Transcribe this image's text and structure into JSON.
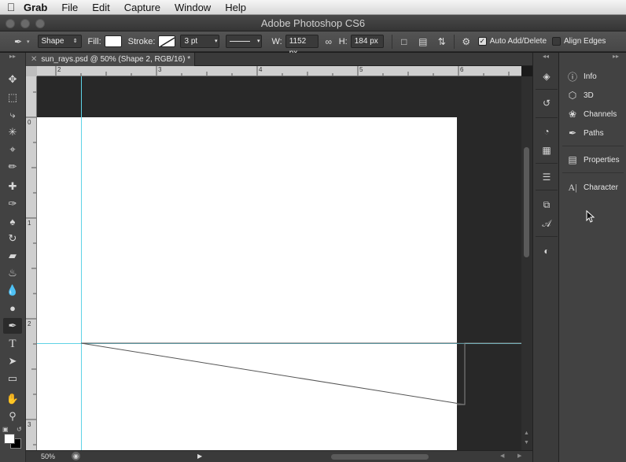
{
  "menubar": {
    "app_name": "Grab",
    "items": [
      "File",
      "Edit",
      "Capture",
      "Window",
      "Help"
    ]
  },
  "window": {
    "title": "Adobe Photoshop CS6"
  },
  "options": {
    "tool_mode": "Shape",
    "fill_label": "Fill:",
    "stroke_label": "Stroke:",
    "stroke_width": "3 pt",
    "w_label": "W:",
    "w_value": "1152 px",
    "h_label": "H:",
    "h_value": "184 px",
    "auto_add_delete": "Auto Add/Delete",
    "auto_add_delete_checked": true,
    "align_edges": "Align Edges",
    "align_edges_checked": false
  },
  "document": {
    "tab_title": "sun_rays.psd @ 50% (Shape 2, RGB/16) *",
    "zoom": "50%",
    "hruler_labels": [
      "2",
      "3",
      "4",
      "5",
      "6"
    ],
    "vruler_labels": [
      "0",
      "1",
      "2",
      "3"
    ]
  },
  "panels": [
    {
      "label": "Info",
      "icon": "info-icon"
    },
    {
      "label": "3D",
      "icon": "cube-icon"
    },
    {
      "label": "Channels",
      "icon": "channels-icon"
    },
    {
      "label": "Paths",
      "icon": "paths-icon"
    },
    {
      "label": "Properties",
      "icon": "properties-icon"
    },
    {
      "label": "Character",
      "icon": "character-icon"
    }
  ],
  "colors": {
    "guide": "#5fd3e6",
    "canvas": "#ffffff",
    "pasteboard": "#282828"
  }
}
